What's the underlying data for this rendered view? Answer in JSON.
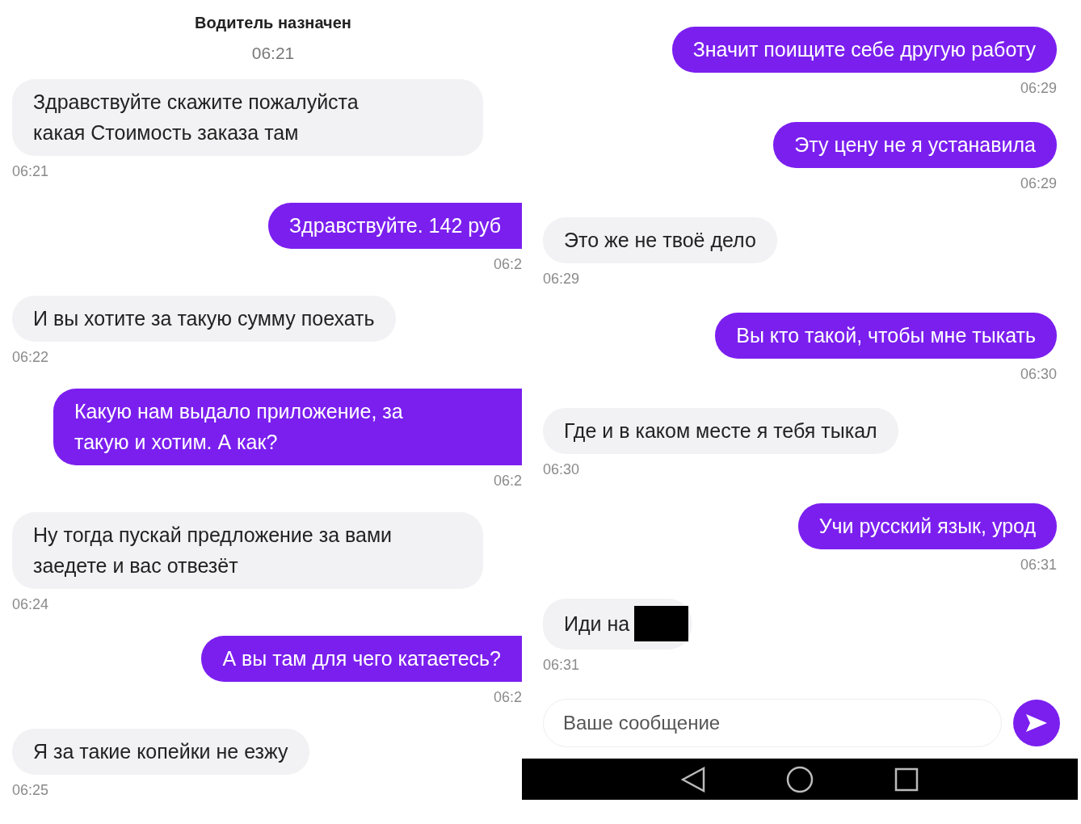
{
  "left": {
    "header": {
      "title": "Водитель назначен",
      "time": "06:21"
    },
    "messages": [
      {
        "kind": "incoming",
        "text": "Здравствуйте скажите пожалуйста какая Стоимость заказа там",
        "time": "06:21",
        "redacted": false
      },
      {
        "kind": "outgoing",
        "text": "Здравствуйте. 142 руб",
        "time": "06:2",
        "redacted": false
      },
      {
        "kind": "incoming",
        "text": "И вы хотите за такую сумму поехать",
        "time": "06:22",
        "redacted": false
      },
      {
        "kind": "outgoing",
        "text": "Какую нам выдало приложение, за такую и хотим. А как?",
        "time": "06:2",
        "redacted": false
      },
      {
        "kind": "incoming",
        "text": "Ну тогда пускай предложение за вами заедете и вас отвезёт",
        "time": "06:24",
        "redacted": false
      },
      {
        "kind": "outgoing",
        "text": "А вы там для чего катаетесь?",
        "time": "06:2",
        "redacted": false
      },
      {
        "kind": "incoming",
        "text": "Я за такие копейки не езжу",
        "time": "06:25",
        "redacted": false
      }
    ]
  },
  "right": {
    "messages": [
      {
        "kind": "outgoing",
        "text": "Значит поищите себе другую работу",
        "time": "06:29",
        "redacted": false
      },
      {
        "kind": "outgoing",
        "text": "Эту цену не я устанавила",
        "time": "06:29",
        "redacted": false
      },
      {
        "kind": "incoming",
        "text": "Это же не твоё дело",
        "time": "06:29",
        "redacted": false
      },
      {
        "kind": "outgoing",
        "text": "Вы кто такой, чтобы мне тыкать",
        "time": "06:30",
        "redacted": false
      },
      {
        "kind": "incoming",
        "text": "Где и в каком месте я тебя тыкал",
        "time": "06:30",
        "redacted": false
      },
      {
        "kind": "outgoing",
        "text": "Учи русский язык, урод",
        "time": "06:31",
        "redacted": false
      },
      {
        "kind": "incoming",
        "text": "Иди на",
        "time": "06:31",
        "redacted": true
      }
    ],
    "composer": {
      "placeholder": "Ваше сообщение"
    }
  }
}
